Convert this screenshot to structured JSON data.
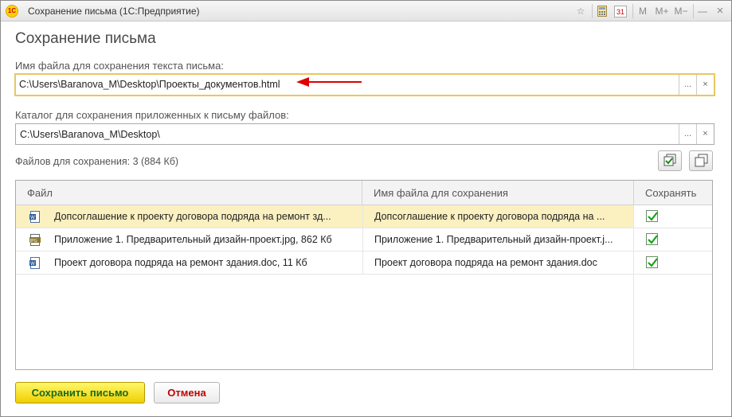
{
  "window": {
    "title": "Сохранение письма  (1С:Предприятие)",
    "app_icon_text": "1С",
    "buttons": {
      "favorites": "☆",
      "calendar_day": "31",
      "memory": "M",
      "memory_plus": "M+",
      "memory_minus": "M−",
      "minimize": "—",
      "close": "×"
    }
  },
  "form": {
    "title": "Сохранение письма",
    "file_label": "Имя файла для сохранения текста письма:",
    "file_value": "C:\\Users\\Baranova_M\\Desktop\\Проекты_документов.html",
    "folder_label": "Каталог для сохранения приложенных к письму файлов:",
    "folder_value": "C:\\Users\\Baranova_M\\Desktop\\",
    "select_button": "...",
    "clear_button": "×",
    "files_count_label": "Файлов для сохранения: 3 (884 Кб)"
  },
  "table": {
    "columns": [
      "Файл",
      "Имя файла для сохранения",
      "Сохранять"
    ],
    "rows": [
      {
        "file": "Допсоглашение к проекту договора подряда на ремонт зд...",
        "save_name": "Допсоглашение к проекту договора подряда на ...",
        "save": true,
        "icon": "word-doc-icon",
        "selected": true
      },
      {
        "file": "Приложение 1. Предварительный дизайн-проект.jpg, 862 Кб",
        "save_name": "Приложение 1. Предварительный дизайн-проект.j...",
        "save": true,
        "icon": "jpg-file-icon",
        "selected": false
      },
      {
        "file": "Проект договора подряда на ремонт здания.doc, 11 Кб",
        "save_name": "Проект договора подряда на ремонт здания.doc",
        "save": true,
        "icon": "word-doc-icon",
        "selected": false
      }
    ]
  },
  "footer": {
    "save_button": "Сохранить письмо",
    "cancel_button": "Отмена"
  },
  "colors": {
    "accent_yellow": "#f0cf00",
    "save_text": "#1a6a1a",
    "cancel_text": "#c00000",
    "selected_row": "#fbf0c0",
    "arrow": "#e00000"
  }
}
